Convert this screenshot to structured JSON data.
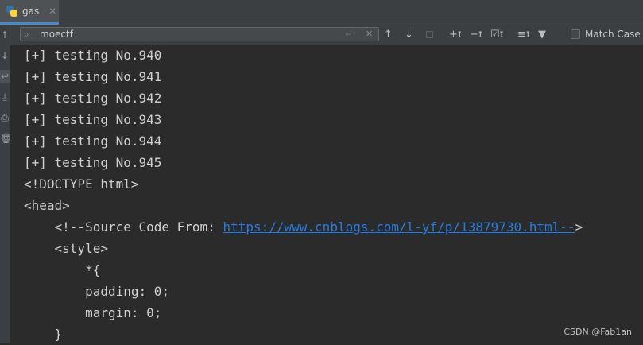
{
  "tab": {
    "title": "gas",
    "close": "✕"
  },
  "search": {
    "value": "moectf",
    "placeholder": ""
  },
  "toolbar": {
    "match_case": "Match Case"
  },
  "console": {
    "lines": [
      "[+] testing No.940",
      "[+] testing No.941",
      "[+] testing No.942",
      "[+] testing No.943",
      "[+] testing No.944",
      "[+] testing No.945",
      "<!DOCTYPE html>",
      "<head>"
    ],
    "comment_prefix": "    <!--Source Code From: ",
    "link": "https://www.cnblogs.com/l-yf/p/13879730.html--",
    "comment_suffix": ">",
    "lines_after": [
      "    <style>",
      "        *{",
      "        padding: 0;",
      "        margin: 0;",
      "    }"
    ]
  },
  "watermark": "CSDN @Fab1an",
  "icons": [
    "python-icon",
    "search-icon",
    "up-arrow-icon",
    "down-arrow-icon",
    "soft-wrap-icon",
    "scroll-to-end-icon",
    "print-icon",
    "trash-icon",
    "filter-icon"
  ]
}
